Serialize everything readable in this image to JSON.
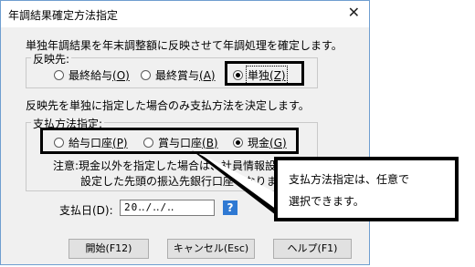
{
  "window": {
    "title": "年調結果確定方法指定",
    "close_glyph": "✕"
  },
  "description_top": "単独年調結果を年末調整額に反映させて年調処理を確定します。",
  "reflect_group": {
    "label": "反映先:",
    "options": [
      {
        "label": "最終給与",
        "key": "(O)",
        "selected": false
      },
      {
        "label": "最終賞与",
        "key": "(A)",
        "selected": false
      },
      {
        "label": "単独",
        "key": "(Z)",
        "selected": true
      }
    ]
  },
  "description_mid": "反映先を単独に指定した場合のみ支払方法を決定します。",
  "payment_group": {
    "label": "支払方法指定:",
    "options": [
      {
        "label": "給与口座",
        "key": "(P)",
        "selected": false
      },
      {
        "label": "賞与口座",
        "key": "(B)",
        "selected": false
      },
      {
        "label": "現金",
        "key": "(G)",
        "selected": true
      }
    ],
    "note_line1": "注意:現金以外を指定した場合は、社員情報設定で",
    "note_line2": "設定した先頭の振込先銀行口座となります。"
  },
  "payment_date": {
    "label": "支払日(D):",
    "value": "20‥/‥/‥",
    "help_glyph": "?"
  },
  "buttons": {
    "start": "開始(F12)",
    "cancel": "キャンセル(Esc)",
    "help": "ヘルプ(F1)"
  },
  "callout": {
    "text": "支払方法指定は、任意で\n選択できます。"
  }
}
